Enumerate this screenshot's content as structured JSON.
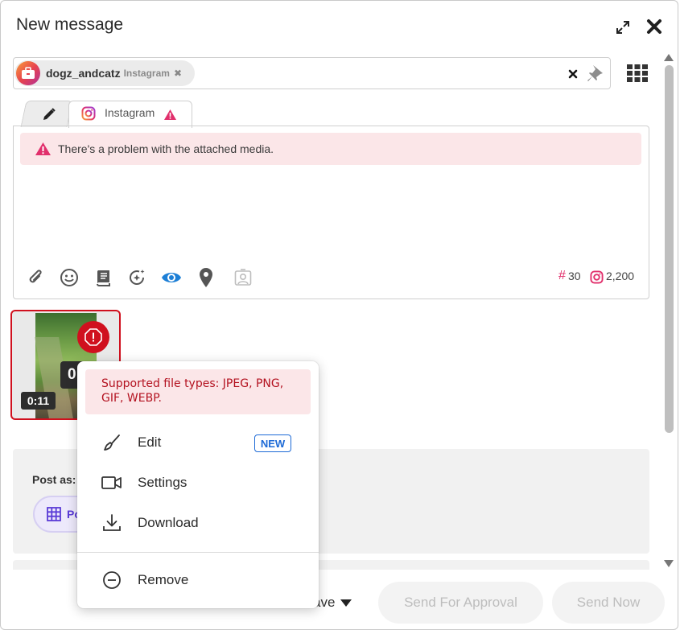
{
  "header": {
    "title": "New message",
    "expand_icon": "expand-arrows-icon",
    "close_icon": "close-icon"
  },
  "recipients": {
    "profile": {
      "name": "dogz_andcatz",
      "network": "Instagram"
    },
    "clear_icon": "close-x-icon",
    "pin_icon": "pushpin-icon",
    "grid_icon": "grid-menu-icon"
  },
  "tabs": [
    {
      "id": "general",
      "icon": "pencil-icon"
    },
    {
      "id": "instagram",
      "label": "Instagram",
      "icon": "instagram-icon",
      "warning_icon": "warning-triangle-icon"
    }
  ],
  "editor": {
    "alert": "There's a problem with the attached media.",
    "toolbar": [
      "paperclip-icon",
      "smiley-icon",
      "library-book-icon",
      "ai-sparkle-icon",
      "preview-eye-icon",
      "location-pin-icon",
      "user-tag-icon"
    ],
    "hashtag_count": "30",
    "char_count": "2,200"
  },
  "media": {
    "duration": "0:11",
    "overlay_partial": "0",
    "error_icon": "error-octagon-icon"
  },
  "menu": {
    "info": "Supported file types: JPEG, PNG, GIF, WEBP.",
    "items": [
      {
        "label": "Edit",
        "icon": "brush-icon",
        "badge": "NEW"
      },
      {
        "label": "Settings",
        "icon": "video-camera-icon"
      },
      {
        "label": "Download",
        "icon": "download-icon"
      },
      {
        "label": "Remove",
        "icon": "minus-circle-icon"
      }
    ]
  },
  "post_as": {
    "label": "Post as:",
    "option_partial": "Po"
  },
  "footer": {
    "save_partial": "ave",
    "send_for_approval": "Send For Approval",
    "send_now": "Send Now"
  },
  "colors": {
    "error": "#d0101e",
    "alert_bg": "#fbe6e8",
    "eye_active": "#1d7fd6",
    "badge_blue": "#1d6ad6",
    "instagram_pink": "#e1306c"
  }
}
